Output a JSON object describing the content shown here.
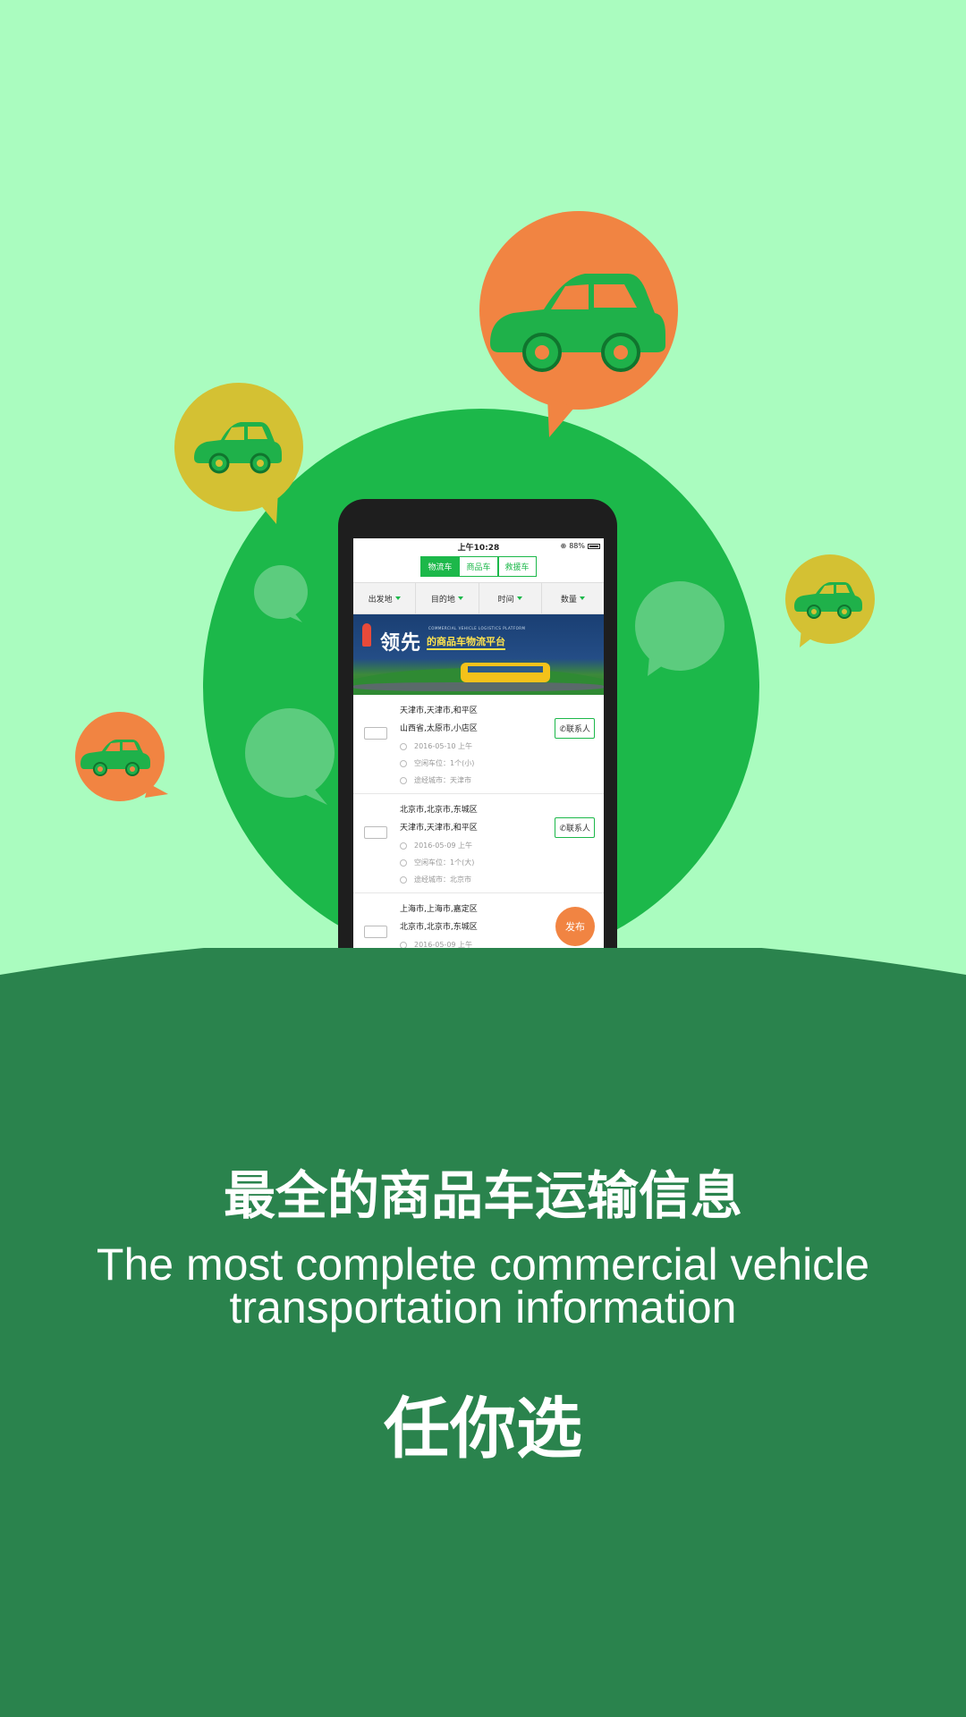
{
  "phone": {
    "status_time": "上午10:28",
    "battery_text": "88%",
    "tabs": [
      "物流车",
      "商品车",
      "救援车"
    ],
    "filters": [
      "出发地",
      "目的地",
      "时间",
      "数量"
    ],
    "banner_title": "领先",
    "banner_subtitle": "的商品车物流平台",
    "banner_small": "COMMERCIAL VEHICLE LOGISTICS PLATFORM",
    "listings": [
      {
        "from": "天津市,天津市,和平区",
        "to": "山西省,太原市,小店区",
        "date": "2016-05-10 上午",
        "seats": "空闲车位：1个(小)",
        "via": "途经城市：天津市",
        "contact": "联系人"
      },
      {
        "from": "北京市,北京市,东城区",
        "to": "天津市,天津市,和平区",
        "date": "2016-05-09 上午",
        "seats": "空闲车位：1个(大)",
        "via": "途经城市：北京市",
        "contact": "联系人"
      },
      {
        "from": "上海市,上海市,嘉定区",
        "to": "北京市,北京市,东城区",
        "date": "2016-05-09 上午",
        "seats": "",
        "via": "",
        "contact": ""
      }
    ],
    "publish_label": "发布"
  },
  "headline": {
    "cn": "最全的商品车运输信息",
    "en_line1": "The most complete commercial vehicle",
    "en_line2": "transportation information",
    "cn2": "任你选"
  },
  "colors": {
    "bg_light": "#aafcbf",
    "bg_dark": "#2a834d",
    "circle": "#1cb84a",
    "orange": "#f18442",
    "yellow": "#d4c133",
    "car": "#1cb84a"
  }
}
